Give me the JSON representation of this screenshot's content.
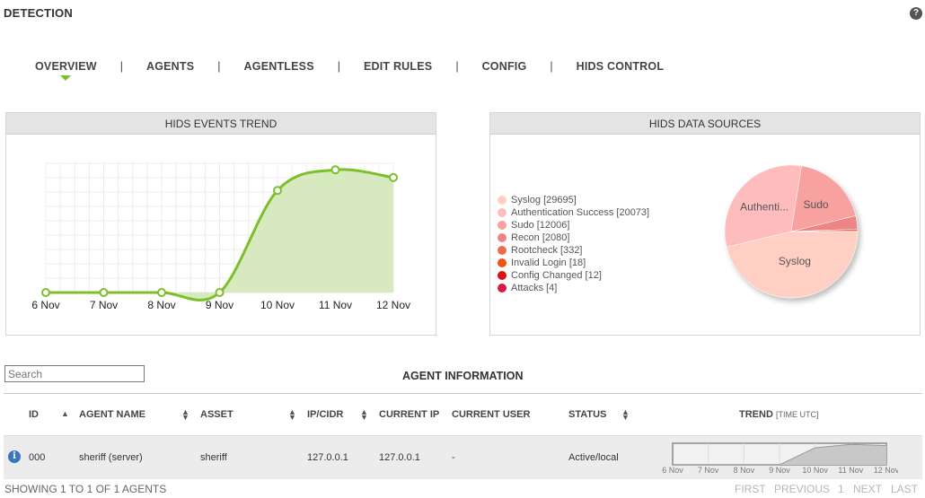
{
  "header": {
    "title": "DETECTION",
    "help": "?"
  },
  "nav": {
    "items": [
      {
        "label": "OVERVIEW",
        "active": true
      },
      {
        "label": "AGENTS"
      },
      {
        "label": "AGENTLESS"
      },
      {
        "label": "EDIT RULES"
      },
      {
        "label": "CONFIG"
      },
      {
        "label": "HIDS CONTROL"
      }
    ],
    "separator": "|"
  },
  "chart_data": [
    {
      "type": "area",
      "title": "HIDS EVENTS TREND",
      "categories": [
        "6 Nov",
        "7 Nov",
        "8 Nov",
        "9 Nov",
        "10 Nov",
        "11 Nov",
        "12 Nov"
      ],
      "values": [
        0,
        0,
        0,
        0,
        79,
        95,
        89
      ],
      "ylim": [
        0,
        100
      ],
      "grid": true,
      "color": "#7cbf2a",
      "fill": "#d6e9bf"
    },
    {
      "type": "pie",
      "title": "HIDS DATA SOURCES",
      "legend_position": "left",
      "slices": [
        {
          "label": "Syslog",
          "value": 29695,
          "color": "#ffcfc4"
        },
        {
          "label": "Authentication Success",
          "value": 20073,
          "color": "#ffbcbc"
        },
        {
          "label": "Sudo",
          "value": 12006,
          "color": "#f7a1a1"
        },
        {
          "label": "Recon",
          "value": 2080,
          "color": "#ee8585"
        },
        {
          "label": "Rootcheck",
          "value": 332,
          "color": "#ee6a4f"
        },
        {
          "label": "Invalid Login",
          "value": 18,
          "color": "#f05218"
        },
        {
          "label": "Config Changed",
          "value": 12,
          "color": "#d81414"
        },
        {
          "label": "Attacks",
          "value": 4,
          "color": "#d61a46"
        }
      ],
      "slice_labels": [
        "Syslog",
        "Authenti...",
        "Sudo"
      ]
    },
    {
      "type": "area",
      "title": "",
      "categories": [
        "6 Nov",
        "7 Nov",
        "8 Nov",
        "9 Nov",
        "10 Nov",
        "11 Nov",
        "12 Nov"
      ],
      "values": [
        0,
        0,
        0,
        0,
        79,
        95,
        89
      ],
      "ylim": [
        0,
        100
      ],
      "color": "#999999",
      "fill": "#c8c8c8"
    }
  ],
  "legend_items": [
    "Syslog [29695]",
    "Authentication Success [20073]",
    "Sudo [12006]",
    "Recon [2080]",
    "Rootcheck [332]",
    "Invalid Login [18]",
    "Config Changed [12]",
    "Attacks [4]"
  ],
  "search": {
    "placeholder": "Search"
  },
  "agents": {
    "title": "AGENT INFORMATION",
    "columns": {
      "id": "ID",
      "agent_name": "AGENT NAME",
      "asset": "ASSET",
      "ip": "IP/CIDR",
      "current_ip": "CURRENT IP",
      "current_user": "CURRENT USER",
      "status": "STATUS",
      "trend": "TREND",
      "trend_sub": "[TIME UTC]"
    },
    "rows": [
      {
        "id": "000",
        "agent_name": "sheriff (server)",
        "asset": "sheriff",
        "ip": "127.0.0.1",
        "current_ip": "127.0.0.1",
        "current_user": "-",
        "status": "Active/local"
      }
    ]
  },
  "footer": {
    "showing": "SHOWING 1 TO 1 OF 1 AGENTS",
    "first": "FIRST",
    "previous": "PREVIOUS",
    "page": "1",
    "next": "NEXT",
    "last": "LAST"
  }
}
